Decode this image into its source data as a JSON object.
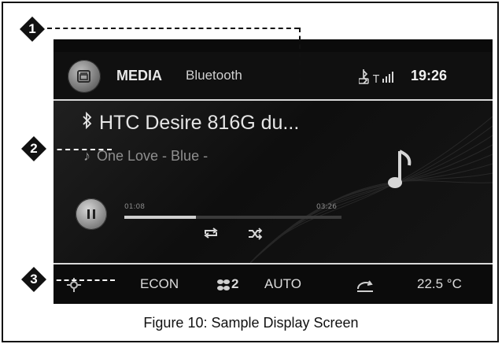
{
  "header": {
    "title": "MEDIA",
    "source": "Bluetooth",
    "clock": "19:26"
  },
  "player": {
    "device_name": "HTC Desire 816G du...",
    "song": "One Love - Blue -",
    "elapsed": "01:08",
    "duration": "03:26",
    "progress_fraction": 0.33
  },
  "climate": {
    "mode": "ECON",
    "fan_level": "2",
    "auto_label": "AUTO",
    "temperature": "22.5 °C"
  },
  "callouts": [
    "1",
    "2",
    "3"
  ],
  "caption": "Figure 10: Sample Display Screen",
  "icons": {
    "media": "media-source-icon",
    "bluetooth": "bluetooth-icon",
    "signal": "signal-strength-icon",
    "music": "music-note-icon",
    "pause": "pause-icon",
    "repeat": "repeat-icon",
    "shuffle": "shuffle-icon",
    "settings": "gear-icon",
    "fan": "fan-icon",
    "recirculation": "air-recirculation-icon"
  }
}
